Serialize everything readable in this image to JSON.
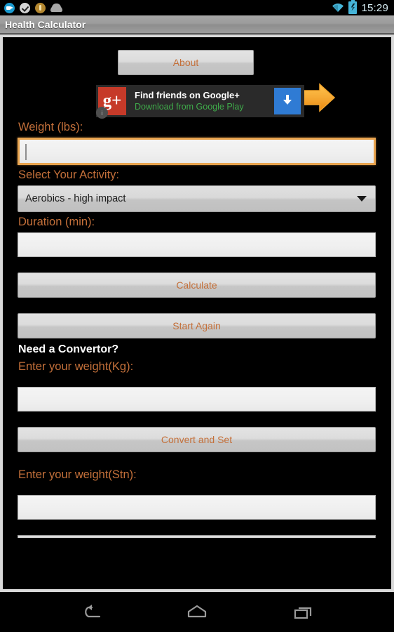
{
  "status_bar": {
    "icons": [
      "camera-icon",
      "check-circle-icon",
      "coin-icon",
      "android-head-icon"
    ],
    "wifi_icon": "wifi-icon",
    "battery_icon": "battery-charging-icon",
    "clock": "15:29",
    "accent_color": "#46b4d8"
  },
  "title_bar": {
    "title": "Health Calculator"
  },
  "header": {
    "about_label": "About",
    "arrow_icon": "right-arrow-icon"
  },
  "ad": {
    "logo_text": "g+",
    "logo_badge": "i",
    "title": "Find friends on Google+",
    "subtitle": "Download from Google Play",
    "cta_icon": "download-arrow-icon",
    "cta_color": "#2f7bd4",
    "subtitle_color": "#3faa4a"
  },
  "form": {
    "weight_label": "Weight (lbs):",
    "weight_value": "",
    "weight_placeholder": "",
    "activity_label": "Select Your Activity:",
    "activity_selected": "Aerobics - high impact",
    "activity_options": [
      "Aerobics - high impact"
    ],
    "duration_label": "Duration (min):",
    "duration_value": "",
    "duration_placeholder": "",
    "calculate_label": "Calculate",
    "start_again_label": "Start Again"
  },
  "convertor": {
    "heading": "Need a Convertor?",
    "kg_label": "Enter your weight(Kg):",
    "kg_value": "",
    "kg_placeholder": "",
    "convert_label": "Convert and Set",
    "stn_label": "Enter your weight(Stn):",
    "stn_value": "",
    "stn_placeholder": ""
  },
  "nav_bar": {
    "back_icon": "back-arrow-icon",
    "home_icon": "home-icon",
    "recents_icon": "recent-apps-icon"
  },
  "colors": {
    "label_orange": "#c4703a",
    "focus_orange": "#e8a34e",
    "background": "#000000",
    "title_bar": "#9a9a9a"
  }
}
